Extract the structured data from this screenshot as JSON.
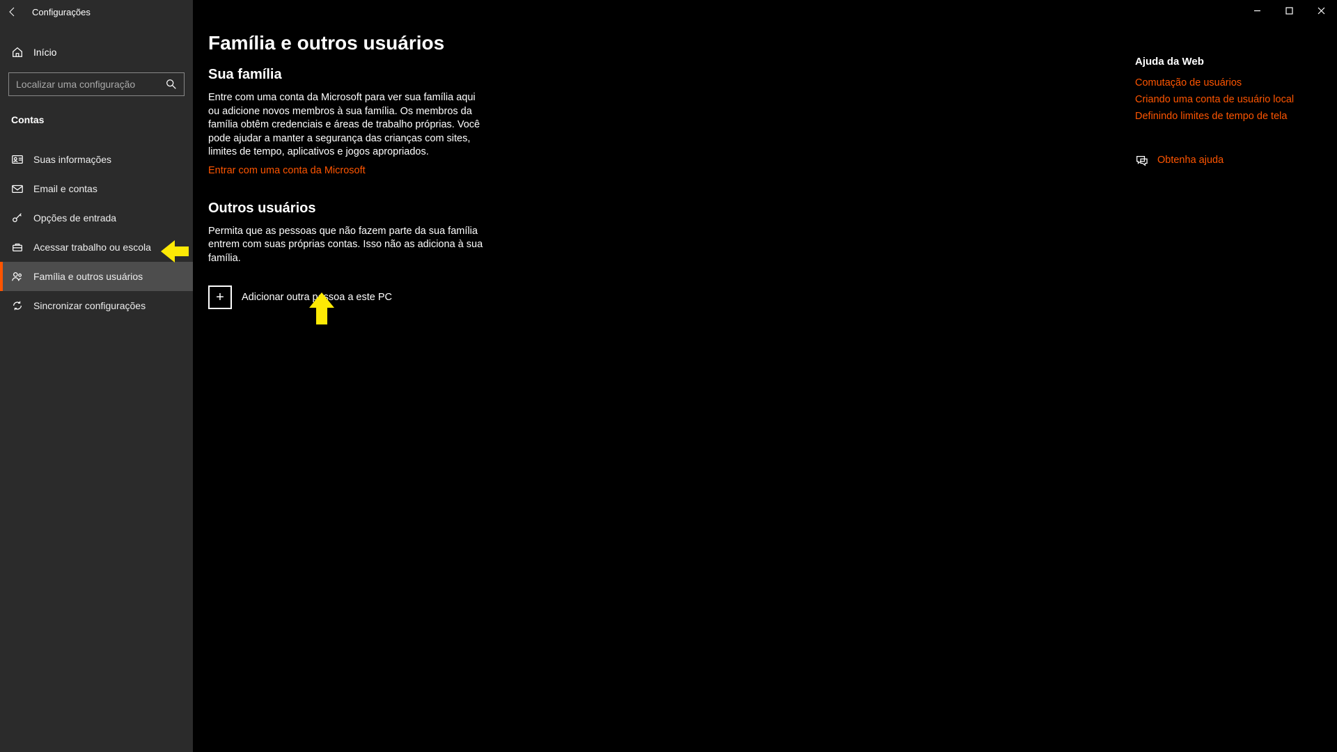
{
  "window": {
    "title": "Configurações"
  },
  "sidebar": {
    "home_label": "Início",
    "search_placeholder": "Localizar uma configuração",
    "group_title": "Contas",
    "items": [
      {
        "label": "Suas informações"
      },
      {
        "label": "Email e contas"
      },
      {
        "label": "Opções de entrada"
      },
      {
        "label": "Acessar trabalho ou escola"
      },
      {
        "label": "Família e outros usuários"
      },
      {
        "label": "Sincronizar configurações"
      }
    ]
  },
  "main": {
    "page_title": "Família e outros usuários",
    "family": {
      "heading": "Sua família",
      "body": "Entre com uma conta da Microsoft para ver sua família aqui ou adicione novos membros à sua família. Os membros da família obtêm credenciais e áreas de trabalho próprias. Você pode ajudar a manter a segurança das crianças com sites, limites de tempo, aplicativos e jogos apropriados.",
      "signin_link": "Entrar com uma conta da Microsoft"
    },
    "others": {
      "heading": "Outros usuários",
      "body": "Permita que as pessoas que não fazem parte da sua família entrem com suas próprias contas. Isso não as adiciona à sua família.",
      "add_label": "Adicionar outra pessoa a este PC"
    }
  },
  "help": {
    "title": "Ajuda da Web",
    "links": [
      "Comutação de usuários",
      "Criando uma conta de usuário local",
      "Definindo limites de tempo de tela"
    ],
    "get_help": "Obtenha ajuda"
  }
}
